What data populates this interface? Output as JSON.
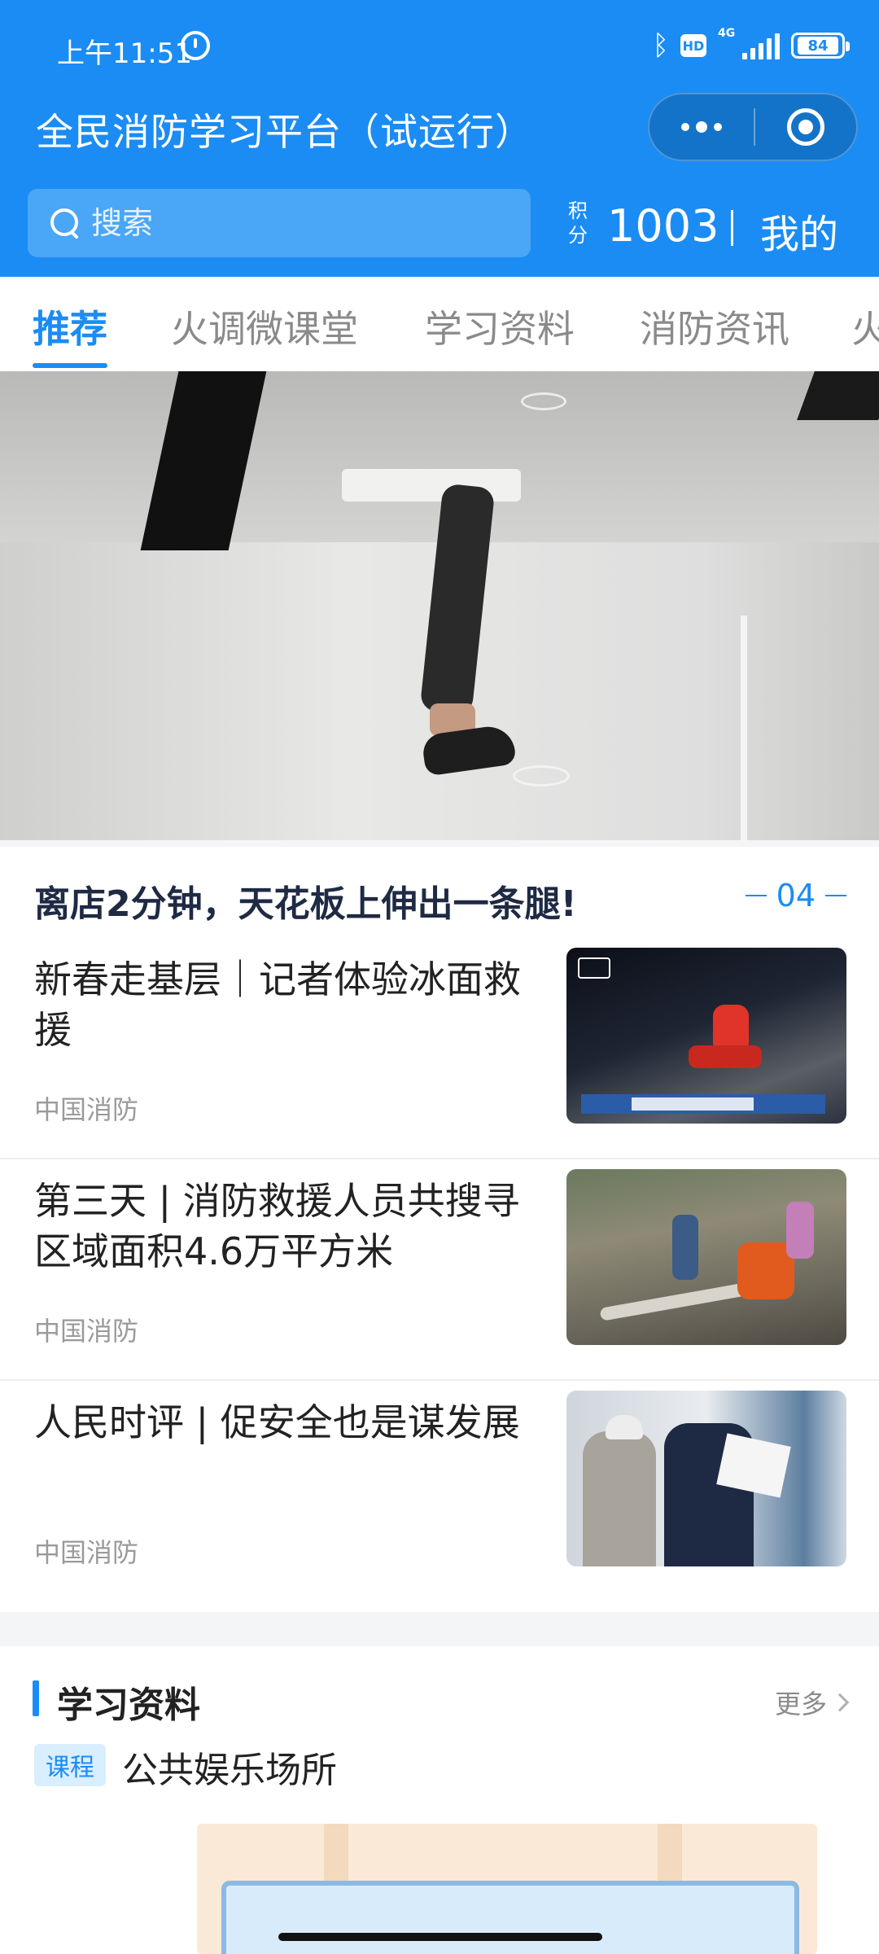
{
  "status_bar": {
    "time": "上午11:51",
    "network": "4G",
    "hd": "HD",
    "battery": "84"
  },
  "header": {
    "title": "全民消防学习平台（试运行）",
    "search_placeholder": "搜索",
    "points_label": "积分",
    "points_value": "1003",
    "mine_label": "我的"
  },
  "tabs": [
    {
      "label": "推荐",
      "active": true
    },
    {
      "label": "火调微课堂",
      "active": false
    },
    {
      "label": "学习资料",
      "active": false
    },
    {
      "label": "消防资讯",
      "active": false
    },
    {
      "label": "火",
      "active": false
    }
  ],
  "featured": {
    "headline": "离店2分钟，天花板上伸出一条腿!",
    "page": "04"
  },
  "news": [
    {
      "title": "新春走基层｜记者体验冰面救援",
      "source": "中国消防"
    },
    {
      "title": "第三天 | 消防救援人员共搜寻区域面积4.6万平方米",
      "source": "中国消防"
    },
    {
      "title": "人民时评 | 促安全也是谋发展",
      "source": "中国消防"
    }
  ],
  "study": {
    "title": "学习资料",
    "more": "更多",
    "tag": "课程",
    "course": "公共娱乐场所"
  },
  "colors": {
    "accent": "#1b8cf3",
    "header_bg": "#1b8cf3"
  }
}
